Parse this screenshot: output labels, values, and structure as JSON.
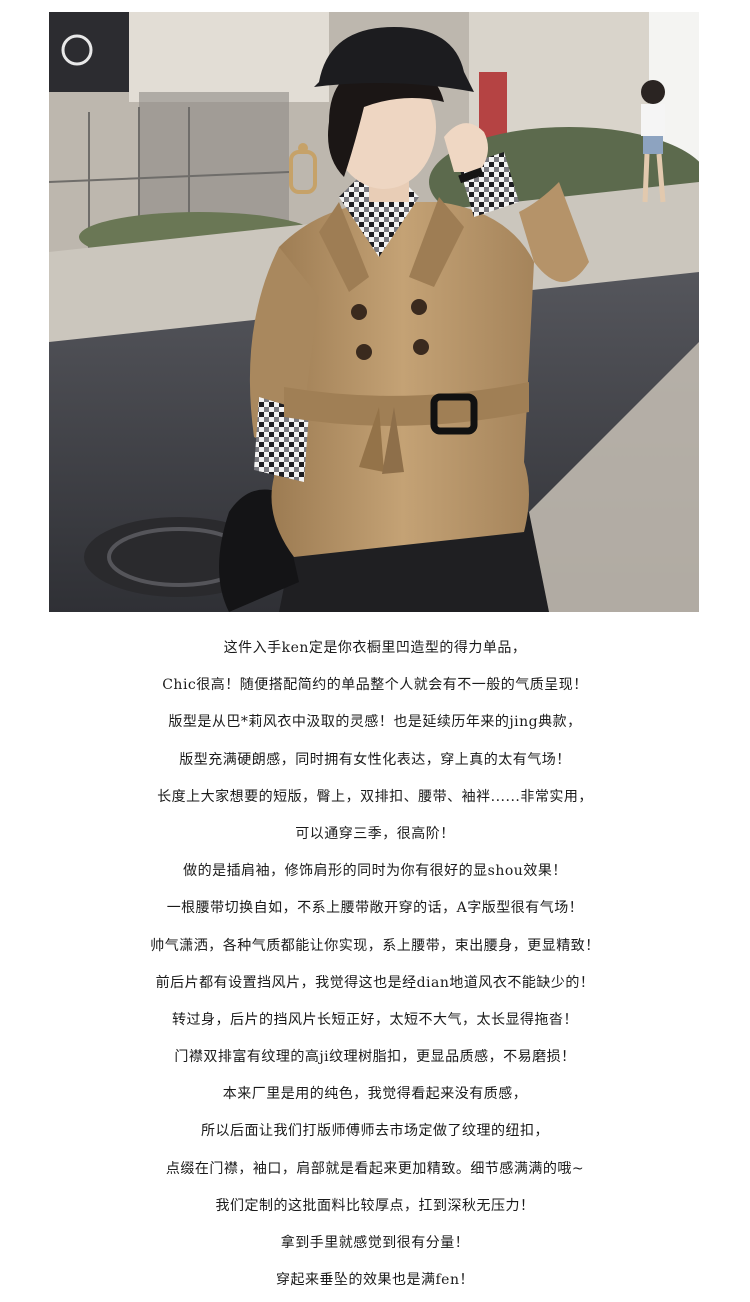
{
  "photo": {
    "alt": "",
    "accent_colors": {
      "coat": "#b8966a",
      "coat_shadow": "#8e6f4a",
      "hat": "#1c1c1f",
      "plaid_dark": "#1d1d22",
      "plaid_light": "#f2f2f2",
      "road": "#3d3e44",
      "sidewalk": "#cbc6bd"
    }
  },
  "copy": {
    "lines": [
      "这件入手ken定是你衣橱里凹造型的得力单品，",
      "Chic很高！随便搭配简约的单品整个人就会有不一般的气质呈现！",
      "版型是从巴*莉风衣中汲取的灵感！也是延续历年来的jing典款，",
      "版型充满硬朗感，同时拥有女性化表达，穿上真的太有气场！",
      "长度上大家想要的短版，臀上，双排扣、腰带、袖袢......非常实用，",
      "可以通穿三季，很高阶！",
      "做的是插肩袖，修饰肩形的同时为你有很好的显shou效果！",
      "一根腰带切换自如，不系上腰带敞开穿的话，A字版型很有气场！",
      "帅气潇洒，各种气质都能让你实现，系上腰带，束出腰身，更显精致！",
      "前后片都有设置挡风片，我觉得这也是经dian地道风衣不能缺少的！",
      "转过身，后片的挡风片长短正好，太短不大气，太长显得拖沓！",
      "门襟双排富有纹理的高ji纹理树脂扣，更显品质感，不易磨损！",
      "本来厂里是用的纯色，我觉得看起来没有质感，",
      "所以后面让我们打版师傅师去市场定做了纹理的纽扣，",
      "点缀在门襟，袖口，肩部就是看起来更加精致。细节感满满的哦~",
      "我们定制的这批面料比较厚点，扛到深秋无压力！",
      "拿到手里就感觉到很有分量！",
      "穿起来垂坠的效果也是满fen！"
    ]
  }
}
